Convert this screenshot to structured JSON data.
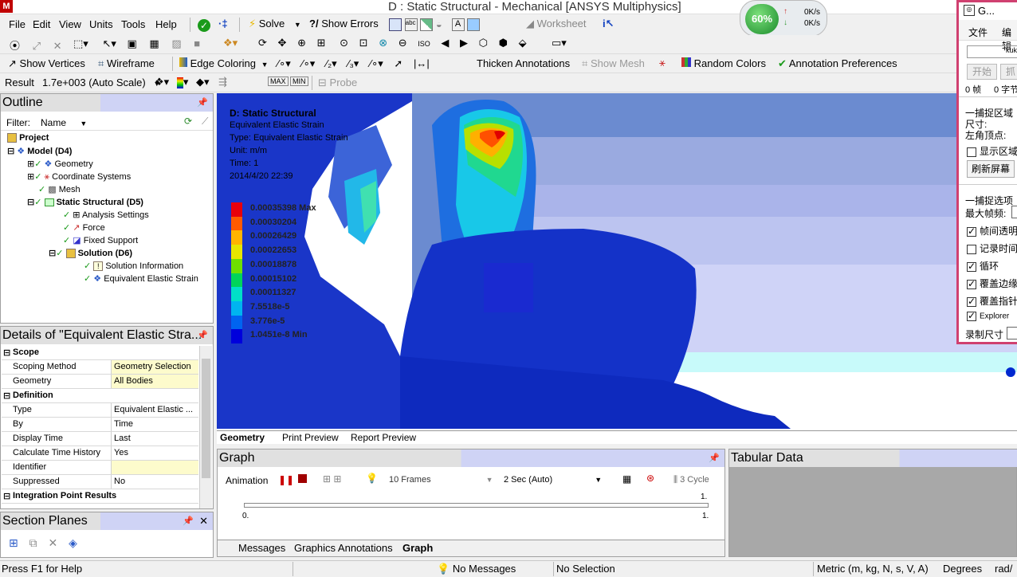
{
  "window": {
    "title": "D : Static Structural - Mechanical [ANSYS Multiphysics]",
    "logo": "M"
  },
  "menu": [
    "File",
    "Edit",
    "View",
    "Units",
    "Tools",
    "Help"
  ],
  "toolbar1": {
    "solve": "Solve",
    "show_errors": "Show Errors",
    "worksheet": "Worksheet"
  },
  "toolbar3": {
    "show_vertices": "Show Vertices",
    "wireframe": "Wireframe",
    "edge_coloring": "Edge Coloring",
    "thicken_annotations": "Thicken Annotations",
    "show_mesh": "Show Mesh",
    "random_colors": "Random Colors",
    "annotation_preferences": "Annotation Preferences"
  },
  "toolbar4": {
    "result_label": "Result",
    "scale": "1.7e+003 (Auto Scale)",
    "probe": "Probe",
    "max": "MAX",
    "min": "MIN"
  },
  "outline": {
    "title": "Outline",
    "filter_label": "Filter:",
    "filter_value": "Name",
    "tree": [
      {
        "label": "Project",
        "bold": true
      },
      {
        "label": "Model (D4)",
        "bold": true
      },
      {
        "label": "Geometry",
        "bold": false
      },
      {
        "label": "Coordinate Systems",
        "bold": false
      },
      {
        "label": "Mesh",
        "bold": false
      },
      {
        "label": "Static Structural (D5)",
        "bold": true
      },
      {
        "label": "Analysis Settings",
        "bold": false
      },
      {
        "label": "Force",
        "bold": false
      },
      {
        "label": "Fixed Support",
        "bold": false
      },
      {
        "label": "Solution (D6)",
        "bold": true
      },
      {
        "label": "Solution Information",
        "bold": false
      },
      {
        "label": "Equivalent Elastic Strain",
        "bold": false
      }
    ]
  },
  "details": {
    "title": "Details of \"Equivalent Elastic Stra...",
    "rows": [
      {
        "key": "Scope",
        "value": "",
        "section": true
      },
      {
        "key": "Scoping Method",
        "value": "Geometry Selection",
        "yellow": true
      },
      {
        "key": "Geometry",
        "value": "All Bodies",
        "yellow": true
      },
      {
        "key": "Definition",
        "value": "",
        "section": true
      },
      {
        "key": "Type",
        "value": "Equivalent Elastic ..."
      },
      {
        "key": "By",
        "value": "Time"
      },
      {
        "key": "Display Time",
        "value": "Last"
      },
      {
        "key": "Calculate Time History",
        "value": "Yes"
      },
      {
        "key": "Identifier",
        "value": "",
        "yellow": true
      },
      {
        "key": "Suppressed",
        "value": "No"
      },
      {
        "key": "Integration Point Results",
        "value": "",
        "section": true
      }
    ]
  },
  "section_planes": {
    "title": "Section Planes"
  },
  "viewport": {
    "title": "D: Static Structural",
    "lines": [
      "Equivalent Elastic Strain",
      "Type: Equivalent Elastic Strain",
      "Unit: m/m",
      "Time: 1",
      "2014/4/20 22:39"
    ],
    "legend": [
      {
        "label": "0.00035398 Max",
        "color": "#e8000b"
      },
      {
        "label": "0.00030204",
        "color": "#ff5a00"
      },
      {
        "label": "0.00026429",
        "color": "#ffb400"
      },
      {
        "label": "0.00022653",
        "color": "#e6e600"
      },
      {
        "label": "0.00018878",
        "color": "#6ee000"
      },
      {
        "label": "0.00015102",
        "color": "#00d45a"
      },
      {
        "label": "0.00011327",
        "color": "#00e0c8"
      },
      {
        "label": "7.5518e-5",
        "color": "#00b4f0"
      },
      {
        "label": "3.776e-5",
        "color": "#0064f0"
      },
      {
        "label": "1.0451e-8 Min",
        "color": "#0000dc"
      }
    ],
    "tabs": [
      "Geometry",
      "Print Preview",
      "Report Preview"
    ]
  },
  "graph": {
    "title": "Graph",
    "animation_label": "Animation",
    "frames": "10 Frames",
    "duration": "2 Sec (Auto)",
    "cycles": "3 Cycle",
    "axis_start": "0.",
    "axis_end": "1.",
    "axis_top": "1.",
    "tabs": [
      "Messages",
      "Graphics Annotations",
      "Graph"
    ]
  },
  "tabular": {
    "title": "Tabular Data"
  },
  "status": {
    "help": "Press F1 for Help",
    "messages": "No Messages",
    "selection": "No Selection",
    "units": "Metric (m, kg, N, s, V, A)",
    "degrees": "Degrees",
    "rad": "rad/"
  },
  "capture_window": {
    "title": "G...",
    "menu": [
      "文件",
      "编辑"
    ],
    "field": "kuk",
    "start_btn": "开始",
    "grab_btn": "抓",
    "frames_info": "0 帧",
    "bytes_info": "0 字节",
    "capture_area": "一捕捉区域",
    "size_label": "尺寸:",
    "top_left": "左角顶点:",
    "show_area": "显示区域",
    "refresh": "刷新屏幕",
    "capture_options": "一捕捉选项",
    "max_fps": "最大帧频:",
    "options": [
      {
        "label": "帧间透明",
        "on": true
      },
      {
        "label": "记录时间",
        "on": false
      },
      {
        "label": "循环",
        "on": true
      },
      {
        "label": "覆盖边缘",
        "on": true
      },
      {
        "label": "覆盖指针",
        "on": true
      },
      {
        "label": "Explorer",
        "on": true
      }
    ],
    "record_size": "录制尺寸"
  },
  "net_monitor": {
    "percent": "60%",
    "up": "0K/s",
    "down": "0K/s"
  }
}
